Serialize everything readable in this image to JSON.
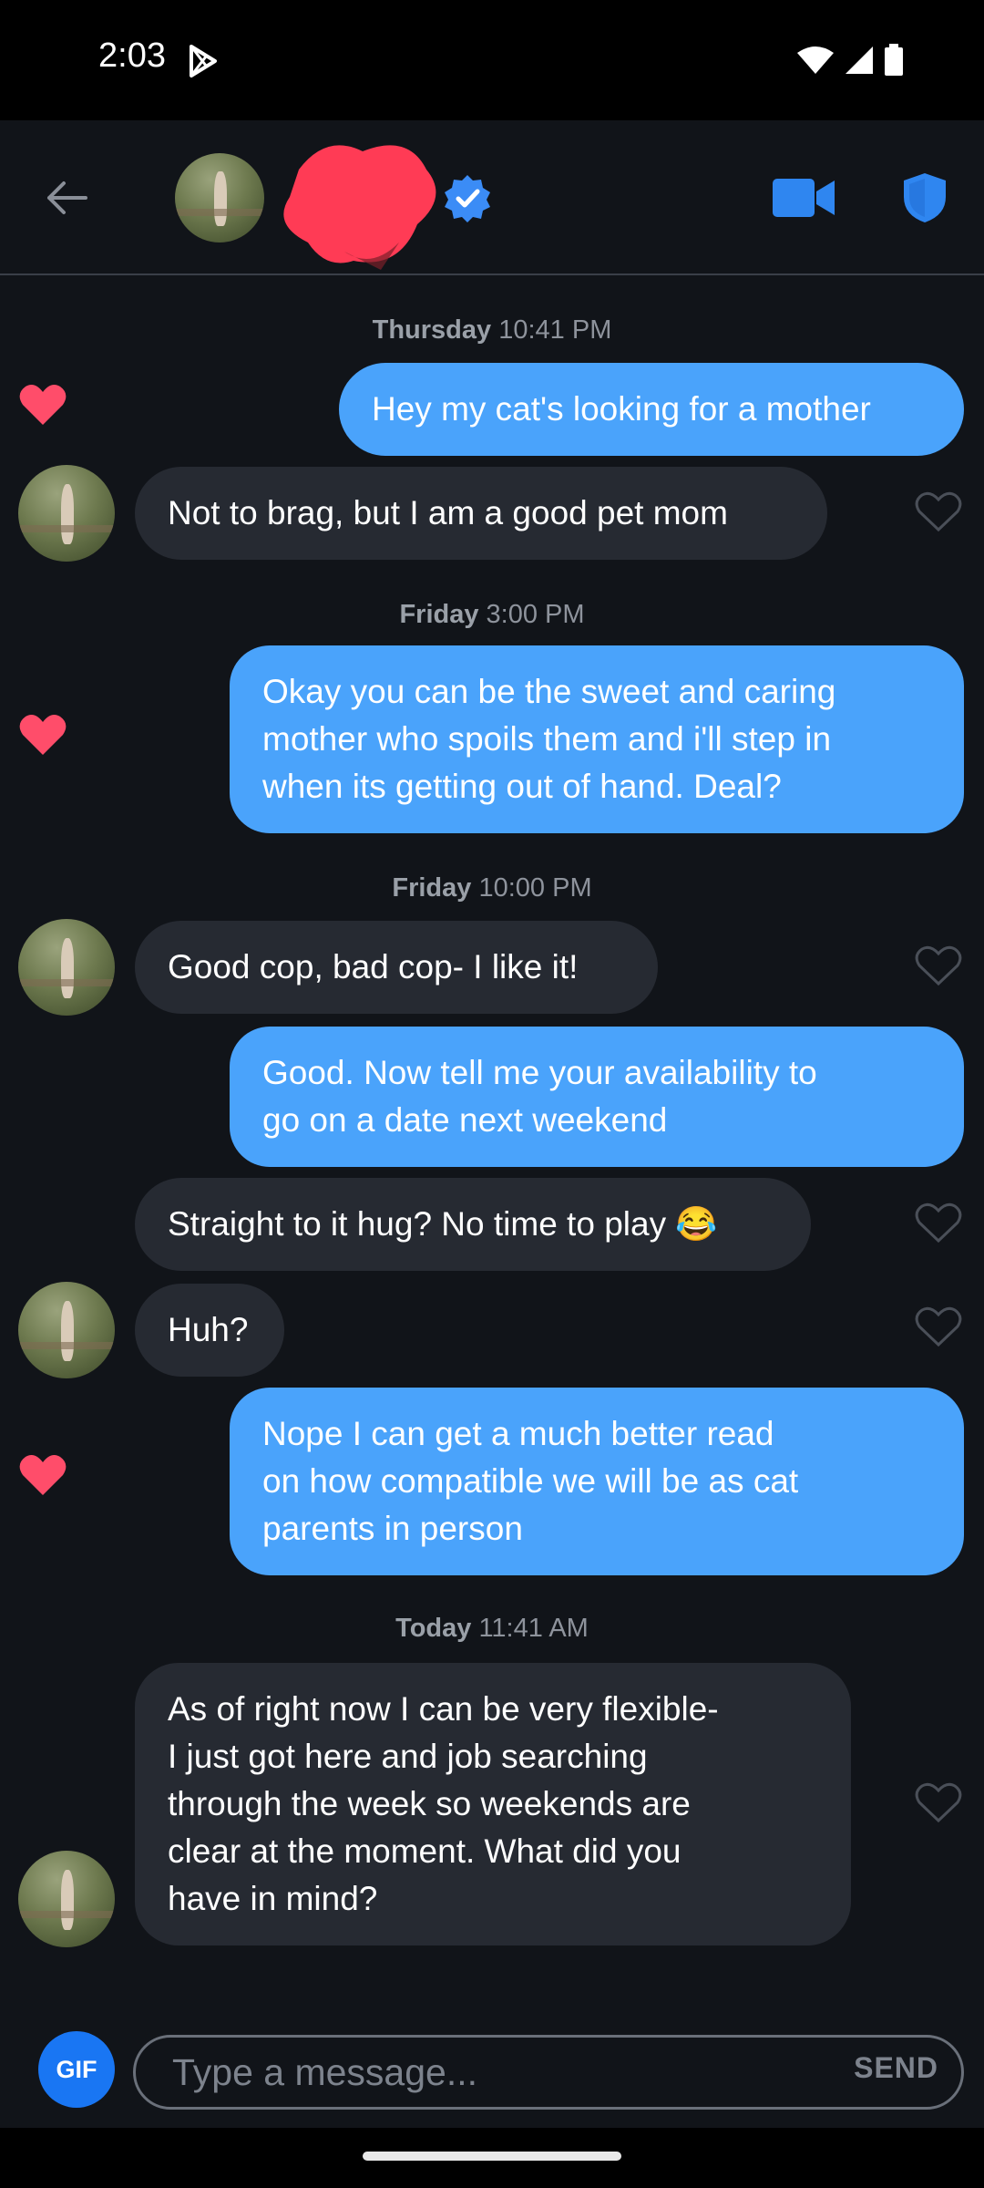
{
  "status": {
    "time": "2:03"
  },
  "header": {
    "verified": true
  },
  "messages": [
    {
      "type": "timestamp",
      "day": "Thursday",
      "time": "10:41 PM"
    },
    {
      "type": "out",
      "text": "Hey my cat's looking for a mother",
      "liked": true
    },
    {
      "type": "in",
      "text": "Not to brag, but I am a good pet mom",
      "liked": false
    },
    {
      "type": "timestamp",
      "day": "Friday",
      "time": "3:00 PM"
    },
    {
      "type": "out",
      "lines": [
        "Okay you can be the sweet and caring",
        "mother who spoils them and i'll step in",
        "when its getting out of hand. Deal?"
      ],
      "liked": true
    },
    {
      "type": "timestamp",
      "day": "Friday",
      "time": "10:00 PM"
    },
    {
      "type": "in",
      "text": "Good cop, bad cop- I like it!",
      "liked": false
    },
    {
      "type": "out",
      "lines": [
        "Good. Now tell me your availability to",
        "go on a date next weekend"
      ],
      "liked": false
    },
    {
      "type": "in",
      "text": "Straight to it hug? No time to play 😂",
      "liked": false
    },
    {
      "type": "in",
      "text": "Huh?",
      "liked": false
    },
    {
      "type": "out",
      "lines": [
        "Nope I can get a much better read",
        "on how compatible we will be as cat",
        "parents in person"
      ],
      "liked": true
    },
    {
      "type": "timestamp",
      "day": "Today",
      "time": "11:41 AM"
    },
    {
      "type": "in",
      "lines": [
        "As of right now I can be very flexible-",
        "I just got here and job searching",
        "through the week so weekends are",
        "clear at the moment. What did you",
        "have in mind?"
      ],
      "liked": false
    }
  ],
  "composer": {
    "gif_label": "GIF",
    "placeholder": "Type a message...",
    "send_label": "SEND"
  },
  "colors": {
    "outgoing": "#4aa3fb",
    "incoming": "#262a32",
    "like": "#ff4d6a",
    "verified": "#3b8cf6"
  }
}
